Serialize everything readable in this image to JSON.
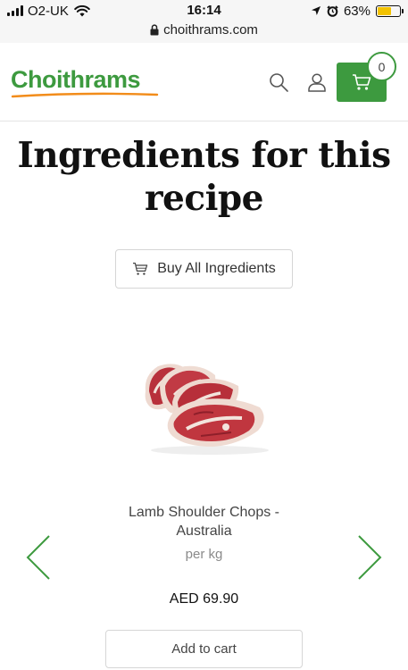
{
  "status_bar": {
    "carrier": "O2-UK",
    "time": "16:14",
    "battery_percent": "63%",
    "battery_level": 0.63,
    "url": "choithrams.com",
    "icons": [
      "signal-icon",
      "wifi-icon",
      "location-arrow-icon",
      "alarm-icon",
      "battery-icon",
      "lock-icon"
    ]
  },
  "header": {
    "logo_text": "Choithrams",
    "cart_count": "0",
    "brand_color": "#3d9a3f",
    "icons": [
      "search-icon",
      "user-icon",
      "cart-icon"
    ]
  },
  "main": {
    "heading_line1": "Ingredients for this",
    "heading_line2": "recipe",
    "buy_all_label": "Buy All Ingredients"
  },
  "product": {
    "name_line1": "Lamb Shoulder Chops -",
    "name_line2": "Australia",
    "unit": "per kg",
    "price": "AED 69.90",
    "add_to_cart_label": "Add to cart",
    "image": "lamb-chops-image"
  },
  "carousel": {
    "arrow_color": "#3d9a3f",
    "icons": [
      "chevron-left-icon",
      "chevron-right-icon"
    ]
  }
}
